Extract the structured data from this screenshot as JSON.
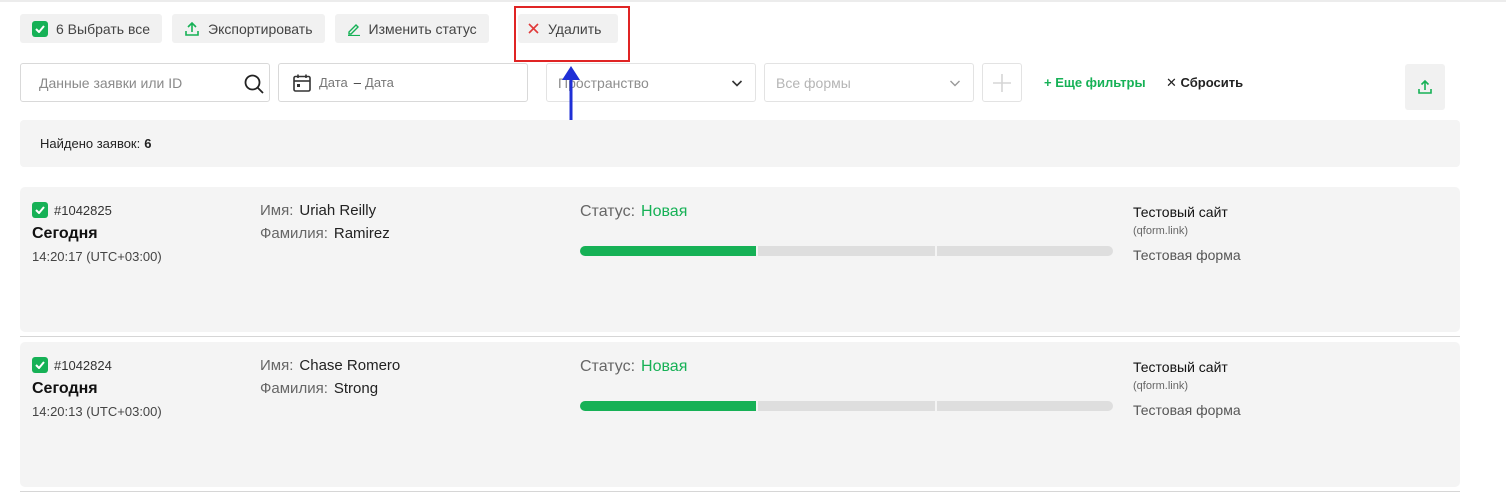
{
  "toolbar": {
    "select_all_label": "6 Выбрать все",
    "export_label": "Экспортировать",
    "change_status_label": "Изменить статус",
    "delete_label": "Удалить"
  },
  "filters": {
    "search_placeholder": "Данные заявки или ID",
    "date_from": "Дата",
    "date_to": "Дата",
    "space_placeholder": "Пространство",
    "forms_placeholder": "Все формы",
    "more_filters_label": "+ Еще фильтры",
    "reset_label": "Сбросить"
  },
  "summary": {
    "found_label": "Найдено заявок:",
    "found_count": "6"
  },
  "colors": {
    "accent": "#16b156",
    "highlight_box": "#e02424",
    "arrow": "#1f2fd6"
  },
  "requests": [
    {
      "id": "#1042825",
      "day": "Сегодня",
      "time": "14:20:17 (UTC+03:00)",
      "first_name_label": "Имя:",
      "first_name": "Uriah Reilly",
      "last_name_label": "Фамилия:",
      "last_name": "Ramirez",
      "status_label": "Статус:",
      "status": "Новая",
      "progress_steps_done": 1,
      "progress_steps_total": 3,
      "site": "Тестовый сайт",
      "site_link": "(qform.link)",
      "form": "Тестовая форма"
    },
    {
      "id": "#1042824",
      "day": "Сегодня",
      "time": "14:20:13 (UTC+03:00)",
      "first_name_label": "Имя:",
      "first_name": "Chase Romero",
      "last_name_label": "Фамилия:",
      "last_name": "Strong",
      "status_label": "Статус:",
      "status": "Новая",
      "progress_steps_done": 1,
      "progress_steps_total": 3,
      "site": "Тестовый сайт",
      "site_link": "(qform.link)",
      "form": "Тестовая форма"
    }
  ]
}
